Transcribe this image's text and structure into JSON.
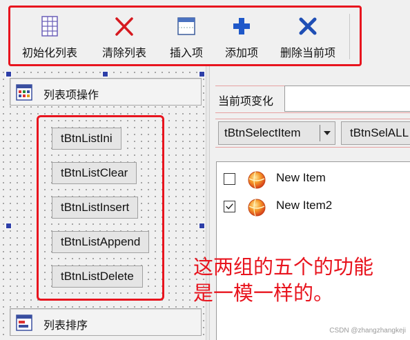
{
  "toolbar": {
    "items": [
      {
        "label": "初始化列表",
        "icon": "grid-list-icon"
      },
      {
        "label": "清除列表",
        "icon": "red-x-icon"
      },
      {
        "label": "插入项",
        "icon": "insert-window-icon"
      },
      {
        "label": "添加项",
        "icon": "blue-plus-icon"
      },
      {
        "label": "删除当前项",
        "icon": "blue-x-icon"
      }
    ]
  },
  "left_panel": {
    "group_top_label": "列表项操作",
    "group_bottom_label": "列表排序",
    "buttons": [
      "tBtnListIni",
      "tBtnListClear",
      "tBtnListInsert",
      "tBtnListAppend",
      "tBtnListDelete"
    ]
  },
  "right_panel": {
    "current_label": "当前项变化",
    "current_value": "",
    "select_item_label": "tBtnSelectItem",
    "select_all_label": "tBtnSelALL",
    "list_items": [
      {
        "text": "New Item",
        "checked": false
      },
      {
        "text": "New Item2",
        "checked": true
      }
    ]
  },
  "annotation": {
    "line1": "这两组的五个的功能",
    "line2": "是一模一样的。"
  },
  "watermark": "CSDN @zhangzhangkeji",
  "colors": {
    "highlight_red": "#e8141e",
    "handle_blue": "#2e3fa8"
  }
}
